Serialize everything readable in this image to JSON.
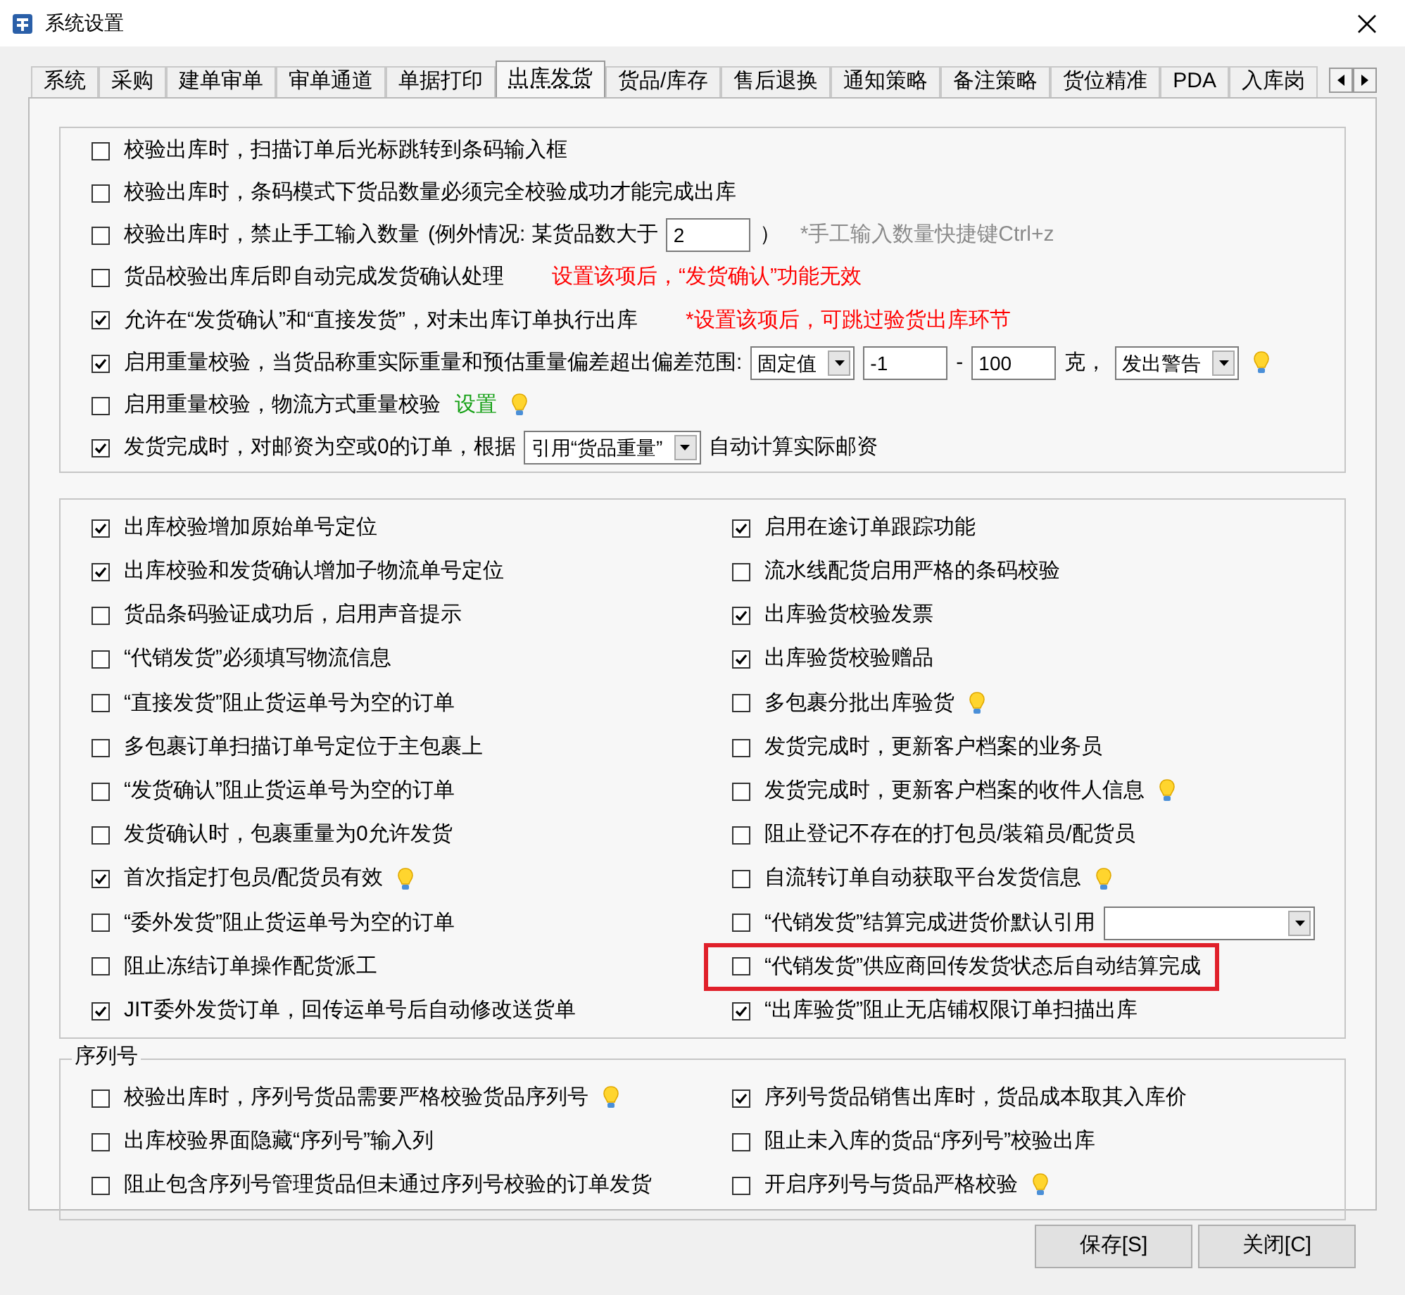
{
  "window": {
    "title": "系统设置"
  },
  "tabs": [
    {
      "label": "系统",
      "selected": false
    },
    {
      "label": "采购",
      "selected": false
    },
    {
      "label": "建单审单",
      "selected": false
    },
    {
      "label": "审单通道",
      "selected": false
    },
    {
      "label": "单据打印",
      "selected": false
    },
    {
      "label": "出库发货",
      "selected": true
    },
    {
      "label": "货品/库存",
      "selected": false
    },
    {
      "label": "售后退换",
      "selected": false
    },
    {
      "label": "通知策略",
      "selected": false
    },
    {
      "label": "备注策略",
      "selected": false
    },
    {
      "label": "货位精准",
      "selected": false
    },
    {
      "label": "PDA",
      "selected": false
    },
    {
      "label": "入库岗",
      "selected": false
    }
  ],
  "top_options": [
    {
      "checked": false,
      "parts": [
        {
          "kind": "text",
          "text": "校验出库时，扫描订单后光标跳转到条码输入框"
        }
      ]
    },
    {
      "checked": false,
      "parts": [
        {
          "kind": "text",
          "text": "校验出库时，条码模式下货品数量必须完全校验成功才能完成出库"
        }
      ]
    },
    {
      "checked": false,
      "parts": [
        {
          "kind": "text",
          "text": "校验出库时，禁止手工输入数量"
        },
        {
          "kind": "text",
          "text": "(例外情况: 某货品数大于"
        },
        {
          "kind": "input",
          "value": "2"
        },
        {
          "kind": "text",
          "text": "）"
        },
        {
          "kind": "hint",
          "text": "*手工输入数量快捷键Ctrl+z"
        }
      ]
    },
    {
      "checked": false,
      "parts": [
        {
          "kind": "text",
          "text": "货品校验出库后即自动完成发货确认处理"
        },
        {
          "kind": "note",
          "text": "设置该项后，“发货确认”功能无效"
        }
      ]
    },
    {
      "checked": true,
      "parts": [
        {
          "kind": "text",
          "text": "允许在“发货确认”和“直接发货”，对未出库订单执行出库"
        },
        {
          "kind": "note",
          "text": "*设置该项后，可跳过验货出库环节"
        }
      ]
    },
    {
      "checked": true,
      "parts": [
        {
          "kind": "text",
          "text": "启用重量校验，当货品称重实际重量和预估重量偏差超出偏差范围:"
        },
        {
          "kind": "select",
          "value": "固定值"
        },
        {
          "kind": "input",
          "value": "-1"
        },
        {
          "kind": "text",
          "text": "-"
        },
        {
          "kind": "input",
          "value": "100"
        },
        {
          "kind": "text",
          "text": "克，"
        },
        {
          "kind": "select",
          "value": "发出警告"
        },
        {
          "kind": "bulb"
        }
      ]
    },
    {
      "checked": false,
      "parts": [
        {
          "kind": "text",
          "text": "启用重量校验，物流方式重量校验"
        },
        {
          "kind": "link",
          "text": "设置"
        },
        {
          "kind": "bulb"
        }
      ]
    },
    {
      "checked": true,
      "parts": [
        {
          "kind": "text",
          "text": "发货完成时，对邮资为空或0的订单，根据"
        },
        {
          "kind": "select",
          "value": "引用“货品重量”"
        },
        {
          "kind": "text",
          "text": "自动计算实际邮资"
        }
      ]
    }
  ],
  "options_left": [
    {
      "checked": true,
      "highlighted": false,
      "parts": [
        {
          "kind": "text",
          "text": "出库校验增加原始单号定位"
        }
      ]
    },
    {
      "checked": true,
      "highlighted": false,
      "parts": [
        {
          "kind": "text",
          "text": "出库校验和发货确认增加子物流单号定位"
        }
      ]
    },
    {
      "checked": false,
      "highlighted": false,
      "parts": [
        {
          "kind": "text",
          "text": "货品条码验证成功后，启用声音提示"
        }
      ]
    },
    {
      "checked": false,
      "highlighted": false,
      "parts": [
        {
          "kind": "text",
          "text": "“代销发货”必须填写物流信息"
        }
      ]
    },
    {
      "checked": false,
      "highlighted": false,
      "parts": [
        {
          "kind": "text",
          "text": "“直接发货”阻止货运单号为空的订单"
        }
      ]
    },
    {
      "checked": false,
      "highlighted": false,
      "parts": [
        {
          "kind": "text",
          "text": "多包裹订单扫描订单号定位于主包裹上"
        }
      ]
    },
    {
      "checked": false,
      "highlighted": false,
      "parts": [
        {
          "kind": "text",
          "text": "“发货确认”阻止货运单号为空的订单"
        }
      ]
    },
    {
      "checked": false,
      "highlighted": false,
      "parts": [
        {
          "kind": "text",
          "text": "发货确认时，包裹重量为0允许发货"
        }
      ]
    },
    {
      "checked": true,
      "highlighted": false,
      "parts": [
        {
          "kind": "text",
          "text": "首次指定打包员/配货员有效"
        },
        {
          "kind": "bulb"
        }
      ]
    },
    {
      "checked": false,
      "highlighted": false,
      "parts": [
        {
          "kind": "text",
          "text": "“委外发货”阻止货运单号为空的订单"
        }
      ]
    },
    {
      "checked": false,
      "highlighted": false,
      "parts": [
        {
          "kind": "text",
          "text": "阻止冻结订单操作配货派工"
        }
      ]
    },
    {
      "checked": true,
      "highlighted": false,
      "parts": [
        {
          "kind": "text",
          "text": "JIT委外发货订单，回传运单号后自动修改送货单"
        }
      ]
    }
  ],
  "options_right": [
    {
      "checked": true,
      "highlighted": false,
      "parts": [
        {
          "kind": "text",
          "text": "启用在途订单跟踪功能"
        }
      ]
    },
    {
      "checked": false,
      "highlighted": false,
      "parts": [
        {
          "kind": "text",
          "text": "流水线配货启用严格的条码校验"
        }
      ]
    },
    {
      "checked": true,
      "highlighted": false,
      "parts": [
        {
          "kind": "text",
          "text": "出库验货校验发票"
        }
      ]
    },
    {
      "checked": true,
      "highlighted": false,
      "parts": [
        {
          "kind": "text",
          "text": "出库验货校验赠品"
        }
      ]
    },
    {
      "checked": false,
      "highlighted": false,
      "parts": [
        {
          "kind": "text",
          "text": "多包裹分批出库验货"
        },
        {
          "kind": "bulb"
        }
      ]
    },
    {
      "checked": false,
      "highlighted": false,
      "parts": [
        {
          "kind": "text",
          "text": "发货完成时，更新客户档案的业务员"
        }
      ]
    },
    {
      "checked": false,
      "highlighted": false,
      "parts": [
        {
          "kind": "text",
          "text": "发货完成时，更新客户档案的收件人信息"
        },
        {
          "kind": "bulb"
        }
      ]
    },
    {
      "checked": false,
      "highlighted": false,
      "parts": [
        {
          "kind": "text",
          "text": "阻止登记不存在的打包员/装箱员/配货员"
        }
      ]
    },
    {
      "checked": false,
      "highlighted": false,
      "parts": [
        {
          "kind": "text",
          "text": "自流转订单自动获取平台发货信息"
        },
        {
          "kind": "bulb"
        }
      ]
    },
    {
      "checked": false,
      "highlighted": false,
      "parts": [
        {
          "kind": "text",
          "text": "“代销发货”结算完成进货价默认引用"
        },
        {
          "kind": "select"
        }
      ]
    },
    {
      "checked": false,
      "highlighted": true,
      "parts": [
        {
          "kind": "text",
          "text": "“代销发货”供应商回传发货状态后自动结算完成"
        }
      ]
    },
    {
      "checked": true,
      "highlighted": false,
      "parts": [
        {
          "kind": "text",
          "text": "“出库验货”阻止无店铺权限订单扫描出库"
        }
      ]
    }
  ],
  "serial_group": {
    "title": "序列号",
    "left": [
      {
        "checked": false,
        "parts": [
          {
            "kind": "text",
            "text": "校验出库时，序列号货品需要严格校验货品序列号"
          },
          {
            "kind": "bulb"
          }
        ]
      },
      {
        "checked": false,
        "parts": [
          {
            "kind": "text",
            "text": "出库校验界面隐藏“序列号”输入列"
          }
        ]
      },
      {
        "checked": false,
        "parts": [
          {
            "kind": "text",
            "text": "阻止包含序列号管理货品但未通过序列号校验的订单发货"
          }
        ]
      }
    ],
    "right": [
      {
        "checked": true,
        "parts": [
          {
            "kind": "text",
            "text": "序列号货品销售出库时，货品成本取其入库价"
          }
        ]
      },
      {
        "checked": false,
        "parts": [
          {
            "kind": "text",
            "text": "阻止未入库的货品“序列号”校验出库"
          }
        ]
      },
      {
        "checked": false,
        "parts": [
          {
            "kind": "text",
            "text": "开启序列号与货品严格校验"
          },
          {
            "kind": "bulb"
          }
        ]
      }
    ]
  },
  "buttons": [
    {
      "label": "保存[S]"
    },
    {
      "label": "关闭[C]"
    }
  ]
}
